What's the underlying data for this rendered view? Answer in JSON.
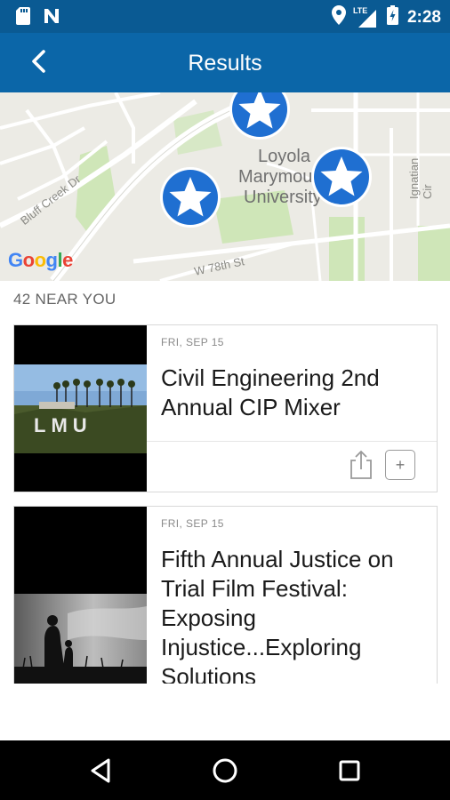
{
  "status_bar": {
    "time": "2:28",
    "network": "LTE",
    "icons": [
      "sd-card-icon",
      "n-notification-icon",
      "location-icon",
      "signal-icon",
      "battery-charging-icon"
    ]
  },
  "app_bar": {
    "title": "Results",
    "back_icon": "back-arrow-icon"
  },
  "map": {
    "streets": [
      "Bluff Creek Dr",
      "W 78th St",
      "Ignatian Cir"
    ],
    "poi_lines": [
      "Loyola",
      "Marymount",
      "University"
    ],
    "logo": "Google",
    "pins": [
      "star-pin-icon",
      "star-pin-icon",
      "star-pin-icon"
    ]
  },
  "list": {
    "header": "42 NEAR YOU",
    "events": [
      {
        "date": "FRI, SEP 15",
        "title": "Civil Engineering 2nd Annual CIP Mixer",
        "image_text": "LMU"
      },
      {
        "date": "FRI, SEP 15",
        "title": "Fifth Annual Justice on Trial Film Festival: Exposing Injustice...Exploring Solutions"
      }
    ],
    "add_label": "+"
  },
  "colors": {
    "status_bar": "#0a5a93",
    "app_bar": "#0b66a8",
    "pin_blue": "#1f6fd1"
  }
}
